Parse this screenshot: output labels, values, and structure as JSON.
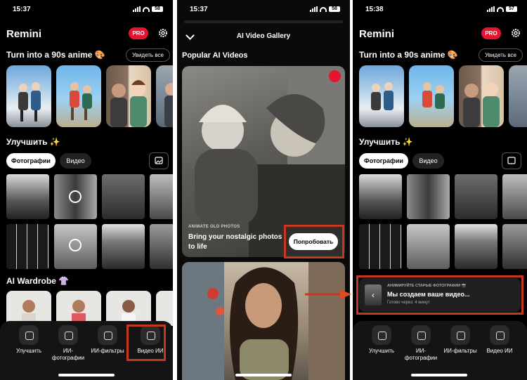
{
  "screen1": {
    "time": "15:37",
    "battery": "58",
    "app_title": "Remini",
    "pro": "PRO",
    "anime_section": "Turn into a 90s anime 🎨",
    "see_all": "Увидеть все",
    "enhance_section": "Улучшить ✨",
    "tab_photos": "Фотографии",
    "tab_video": "Видео",
    "wardrobe_section": "AI Wardrobe 👚",
    "nav": [
      "Улучшить",
      "ИИ-фотографии",
      "ИИ-фильтры",
      "Видео ИИ"
    ]
  },
  "screen2": {
    "time": "15:37",
    "battery": "58",
    "title": "AI Video Gallery",
    "heading": "Popular AI Videos",
    "card_label": "ANIMATE OLD PHOTOS",
    "card_text": "Bring your nostalgic photos to life",
    "try_button": "Попробовать"
  },
  "screen3": {
    "time": "15:38",
    "battery": "57",
    "app_title": "Remini",
    "pro": "PRO",
    "anime_section": "Turn into a 90s anime 🎨",
    "see_all": "Увидеть все",
    "enhance_section": "Улучшить ✨",
    "tab_photos": "Фотографии",
    "tab_video": "Видео",
    "toast_label": "АНИМИРУЙТЕ СТАРЫЕ ФОТОГРАФИИ 📸",
    "toast_title": "Мы создаем ваше видео...",
    "toast_eta": "Готово через: 4 минут",
    "nav": [
      "Улучшить",
      "ИИ-фотографии",
      "ИИ-фильтры",
      "Видео ИИ"
    ]
  },
  "colors": {
    "accent": "#e8132f",
    "highlight": "#c4391e",
    "background": "#000000"
  },
  "icons": [
    "gear-icon",
    "chevron-down-icon",
    "trend-icon",
    "gallery-icon",
    "sparkle-icon",
    "aperture-icon",
    "filter-icon",
    "video-icon",
    "arrow-icon"
  ]
}
